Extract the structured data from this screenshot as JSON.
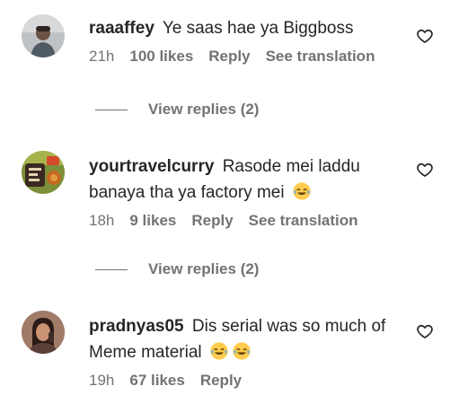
{
  "comments": [
    {
      "username": "raaaffey",
      "text": "Ye saas hae ya Biggboss",
      "time": "21h",
      "likes": "100 likes",
      "reply_label": "Reply",
      "translate_label": "See translation",
      "view_replies": "View replies (2)",
      "liked": false
    },
    {
      "username": "yourtravelcurry",
      "text": "Rasode mei laddu banaya tha ya factory mei",
      "emojis": [
        "face-with-tears-of-joy"
      ],
      "time": "18h",
      "likes": "9 likes",
      "reply_label": "Reply",
      "translate_label": "See translation",
      "view_replies": "View replies (2)",
      "liked": false
    },
    {
      "username": "pradnyas05",
      "text": "Dis serial was so much of Meme material",
      "emojis": [
        "face-with-tears-of-joy",
        "face-with-tears-of-joy"
      ],
      "time": "19h",
      "likes": "67 likes",
      "reply_label": "Reply",
      "liked": false
    }
  ],
  "icons": {
    "like": "heart-outline-icon"
  },
  "colors": {
    "text": "#262626",
    "secondary": "#737373",
    "emoji_face": "#FFCC4D",
    "emoji_tears": "#5DADEC"
  }
}
